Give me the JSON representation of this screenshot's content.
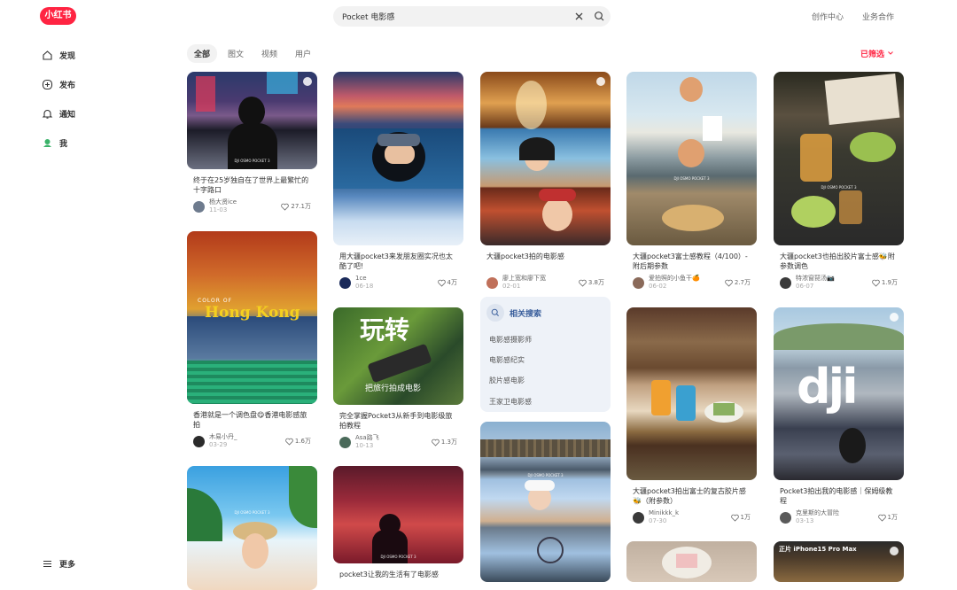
{
  "header": {
    "logo": "小红书",
    "search_value": "Pocket 电影感",
    "links": [
      "创作中心",
      "业务合作"
    ]
  },
  "sidebar": {
    "items": [
      {
        "label": "发现",
        "icon": "home-icon"
      },
      {
        "label": "发布",
        "icon": "plus-icon"
      },
      {
        "label": "通知",
        "icon": "bell-icon"
      },
      {
        "label": "我",
        "icon": "avatar-icon"
      }
    ],
    "more": "更多"
  },
  "tabs": [
    "全部",
    "图文",
    "视频",
    "用户"
  ],
  "filter": "已筛选",
  "related": {
    "title": "相关搜索",
    "items": [
      "电影感摄影师",
      "电影感纪实",
      "胶片感电影",
      "王家卫电影感"
    ]
  },
  "cards": [
    {
      "title": "终于在25岁独自在了世界上最繁忙的十字路口",
      "author": "杨大贤ice",
      "date": "11-03",
      "likes": "27.1万",
      "image_text": "DJI OSMO POCKET 3"
    },
    {
      "title": "香港就是一个调色盘😋香港电影感旅拍",
      "author": "木易小丹_",
      "date": "03-29",
      "likes": "1.6万",
      "image_text": "Hong Kong",
      "image_text2": "COLOR OF"
    },
    {
      "title": "",
      "author": "",
      "date": "",
      "likes": "",
      "image_text": "DJI OSMO POCKET 3"
    },
    {
      "title": "用大疆pocket3来发朋友圈实况也太酷了吧!",
      "author": "1ce",
      "date": "06-18",
      "likes": "4万"
    },
    {
      "title": "完全掌握Pocket3从新手到电影级旅拍教程",
      "author": "Asa路飞",
      "date": "10-13",
      "likes": "1.3万",
      "image_text": "玩转",
      "image_text2": "把旅行拍成电影"
    },
    {
      "title": "pocket3让我的生活有了电影感",
      "author": "",
      "date": "",
      "likes": "",
      "image_text": "DJI OSMO POCKET 3"
    },
    {
      "title": "大疆pocket3拍的电影感",
      "author": "廖上宽和廖下宽",
      "date": "02-01",
      "likes": "3.8万"
    },
    {
      "title": "",
      "author": "",
      "date": "",
      "likes": "",
      "image_text": "DJI OSMO POCKET 3"
    },
    {
      "title": "大疆pocket3富士感教程（4/100）-附后期参数",
      "author": "爱拍照的小鱼干🍊",
      "date": "06-02",
      "likes": "2.7万",
      "image_text": "DJI OSMO POCKET 3"
    },
    {
      "title": "大疆pocket3拍出富士的复古胶片感🐝（附参数）",
      "author": "Minikkk_k",
      "date": "07-30",
      "likes": "1万"
    },
    {
      "title": "",
      "author": "",
      "date": "",
      "likes": ""
    },
    {
      "title": "大疆pocket3也拍出胶片富士感🐝附参数调色",
      "author": "特浓窗琵汤📷",
      "date": "06-07",
      "likes": "1.9万",
      "image_text": "DJI OSMO POCKET 3"
    },
    {
      "title": "Pocket3拍出我的电影感｜保姆级教程",
      "author": "克里斯的大冒险",
      "date": "03-13",
      "likes": "1万",
      "image_text": "dji"
    },
    {
      "title": "",
      "author": "",
      "date": "",
      "likes": "",
      "image_text": "正片 iPhone15 Pro Max"
    }
  ],
  "colors": {
    "accent": "#ff2442",
    "related": "#3a5f9c"
  }
}
